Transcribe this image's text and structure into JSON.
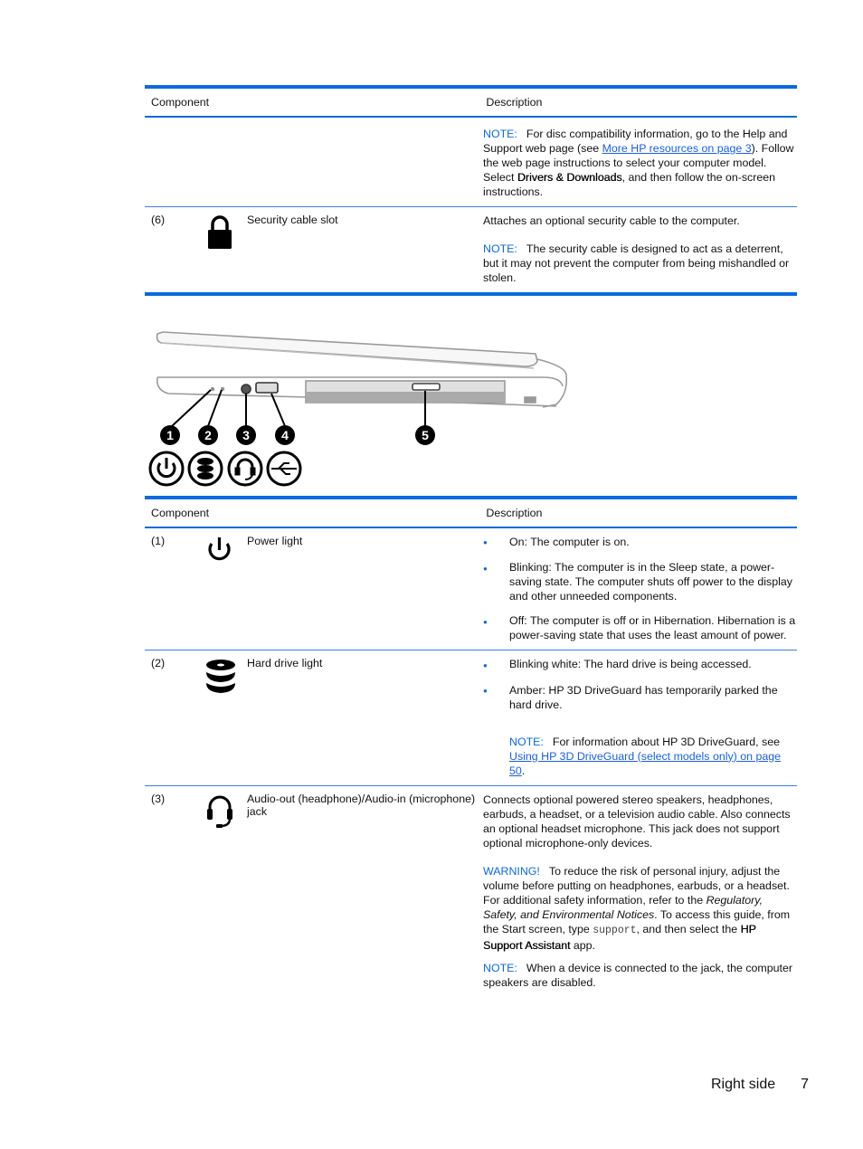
{
  "table1": {
    "headers": {
      "component": "Component",
      "description": "Description"
    },
    "continued_row": {
      "note_label": "NOTE:",
      "note_pre": "For disc compatibility information, go to the Help and Support web page (see ",
      "note_link": "More HP resources on page 3",
      "note_mid": "). Follow the web page instructions to select your computer model. Select ",
      "note_bold": "Drivers & Downloads",
      "note_post": ", and then follow the on-screen instructions."
    },
    "rows": [
      {
        "number": "(6)",
        "icon": "lock-icon",
        "name": "Security cable slot",
        "description": "Attaches an optional security cable to the computer.",
        "note_label": "NOTE:",
        "note": "The security cable is designed to act as a deterrent, but it may not prevent the computer from being mishandled or stolen."
      }
    ]
  },
  "diagram": {
    "callouts": [
      "1",
      "2",
      "3",
      "4",
      "5"
    ],
    "icons": [
      "power-icon",
      "hard-drive-icon",
      "headset-icon",
      "usb-icon"
    ]
  },
  "table2": {
    "headers": {
      "component": "Component",
      "description": "Description"
    },
    "rows": [
      {
        "number": "(1)",
        "icon": "power-icon",
        "name": "Power light",
        "bullets": [
          "On: The computer is on.",
          "Blinking: The computer is in the Sleep state, a power-saving state. The computer shuts off power to the display and other unneeded components.",
          "Off: The computer is off or in Hibernation. Hibernation is a power-saving state that uses the least amount of power."
        ]
      },
      {
        "number": "(2)",
        "icon": "hard-drive-icon",
        "name": "Hard drive light",
        "bullets": [
          "Blinking white: The hard drive is being accessed.",
          "Amber: HP 3D DriveGuard has temporarily parked the hard drive."
        ],
        "note_label": "NOTE:",
        "note_pre": "For information about HP 3D DriveGuard, see ",
        "note_link": "Using HP 3D DriveGuard (select models only) on page 50",
        "note_post": "."
      },
      {
        "number": "(3)",
        "icon": "headset-icon",
        "name": "Audio-out (headphone)/Audio-in (microphone) jack",
        "description": "Connects optional powered stereo speakers, headphones, earbuds, a headset, or a television audio cable. Also connects an optional headset microphone. This jack does not support optional microphone-only devices.",
        "warning_label": "WARNING!",
        "warning_pre": "To reduce the risk of personal injury, adjust the volume before putting on headphones, earbuds, or a headset. For additional safety information, refer to the ",
        "warning_italic": "Regulatory, Safety, and Environmental Notices",
        "warning_mid": ". To access this guide, from the Start screen, type ",
        "warning_code": "support",
        "warning_mid2": ", and then select the ",
        "warning_bold": "HP Support Assistant",
        "warning_post": " app.",
        "note_label": "NOTE:",
        "note": "When a device is connected to the jack, the computer speakers are disabled."
      }
    ]
  },
  "footer": {
    "section": "Right side",
    "page": "7"
  }
}
